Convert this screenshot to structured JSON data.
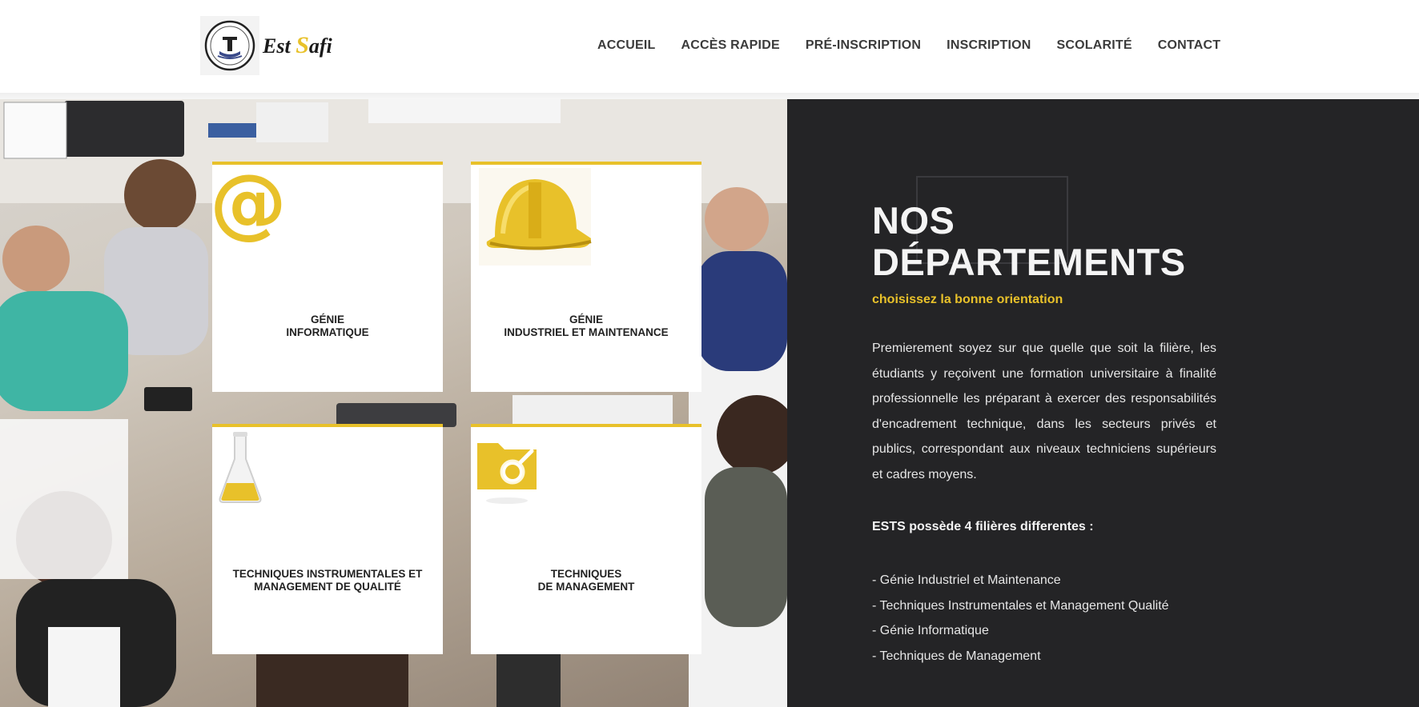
{
  "header": {
    "logo": {
      "text_prefix": "Est ",
      "text_accent": "S",
      "text_suffix": "afi",
      "icon": "school-emblem-icon"
    },
    "nav": [
      "ACCUEIL",
      "ACCÈS RAPIDE",
      "PRÉ-INSCRIPTION",
      "INSCRIPTION",
      "SCOLARITÉ",
      "CONTACT"
    ]
  },
  "departments": [
    {
      "line1": "GÉNIE",
      "line2": "INFORMATIQUE",
      "icon": "at-sign-icon"
    },
    {
      "line1": "GÉNIE",
      "line2": "INDUSTRIEL ET MAINTENANCE",
      "icon": "hard-hat-icon"
    },
    {
      "line1": "TECHNIQUES INSTRUMENTALES ET",
      "line2": "MANAGEMENT DE QUALITÉ",
      "icon": "lab-flask-icon"
    },
    {
      "line1": "TECHNIQUES",
      "line2": "DE MANAGEMENT",
      "icon": "folder-search-icon"
    }
  ],
  "panel": {
    "title_line1": "NOS",
    "title_line2": "DÉPARTEMENTS",
    "subtitle": "choisissez la bonne orientation",
    "paragraph": "Premierement soyez sur que quelle que soit la filière, les étudiants y reçoivent une formation universitaire à finalité professionnelle les préparant à exercer des responsabilités d'encadrement technique, dans les secteurs privés et publics, correspondant aux niveaux techniciens supérieurs et cadres moyens.",
    "list_heading": "ESTS possède 4 filières differentes :",
    "list": [
      "- Génie Industriel et Maintenance",
      "- Techniques Instrumentales et Management Qualité",
      "- Génie Informatique",
      "- Techniques de Management"
    ]
  },
  "colors": {
    "accent": "#e8c12a",
    "panel_bg": "#242426",
    "nav_text": "#3b3b3b"
  }
}
